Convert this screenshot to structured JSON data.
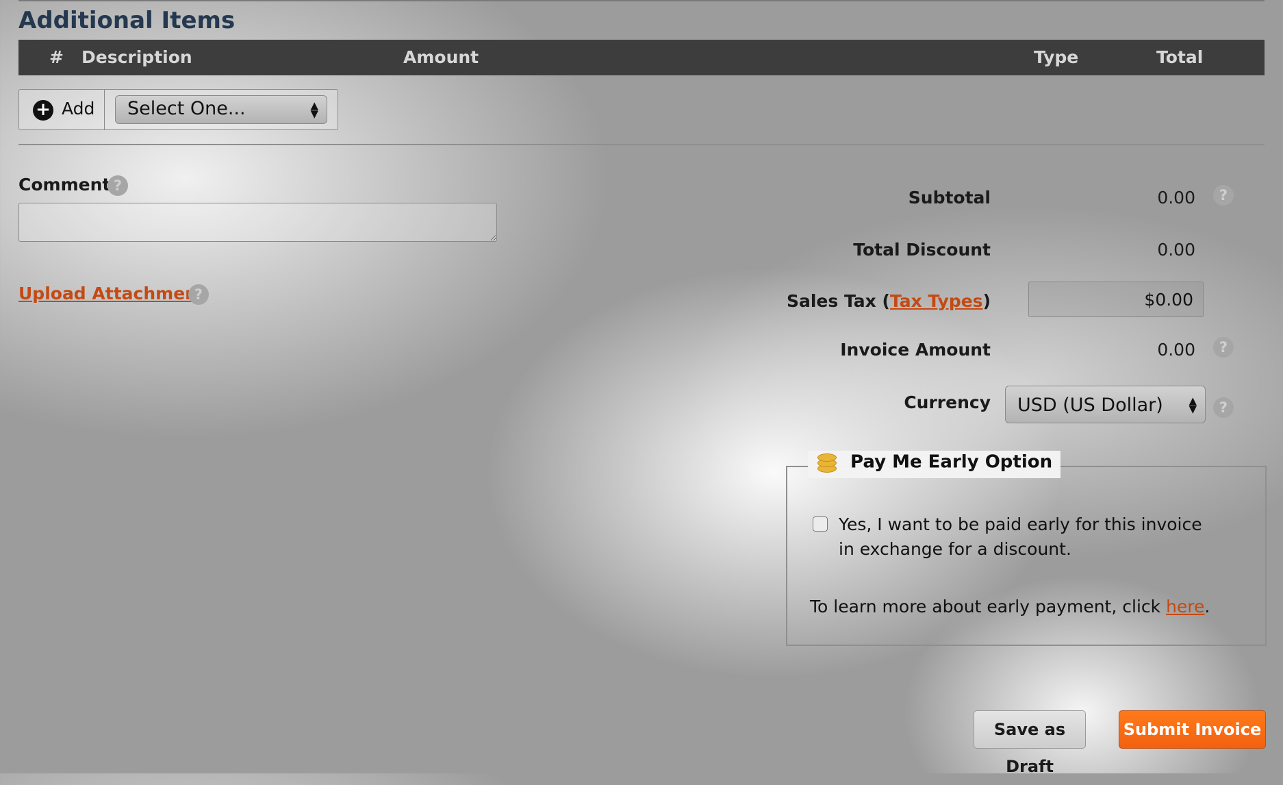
{
  "section": {
    "title": "Additional Items"
  },
  "table": {
    "columns": {
      "number": "#",
      "description": "Description",
      "amount": "Amount",
      "type": "Type",
      "total": "Total"
    }
  },
  "add_row": {
    "add_label": "Add",
    "add_icon": "plus-circle-icon",
    "select_value": "Select One..."
  },
  "comment": {
    "label": "Comment",
    "value": ""
  },
  "upload": {
    "label": "Upload Attachment"
  },
  "summary": {
    "subtotal_label": "Subtotal",
    "subtotal_value": "0.00",
    "discount_label": "Total Discount",
    "discount_value": "0.00",
    "sales_tax_label": "Sales Tax",
    "tax_types_link": "Tax Types",
    "sales_tax_value": "$0.00",
    "invoice_amount_label": "Invoice Amount",
    "invoice_amount_value": "0.00",
    "currency_label": "Currency",
    "currency_value": "USD (US Dollar)"
  },
  "early_pay": {
    "title": "Pay Me Early Option",
    "icon": "coins-icon",
    "checkbox_label": "Yes, I want to be paid early for this invoice in exchange for a discount.",
    "checked": false,
    "learn_prefix": "To learn more about early payment, click ",
    "learn_link": "here",
    "learn_suffix": "."
  },
  "buttons": {
    "save_draft": "Save as Draft",
    "submit": "Submit Invoice"
  },
  "colors": {
    "accent": "#f26110",
    "link": "#c44a13",
    "header_bg": "#3d3d3d",
    "title": "#24384f"
  }
}
